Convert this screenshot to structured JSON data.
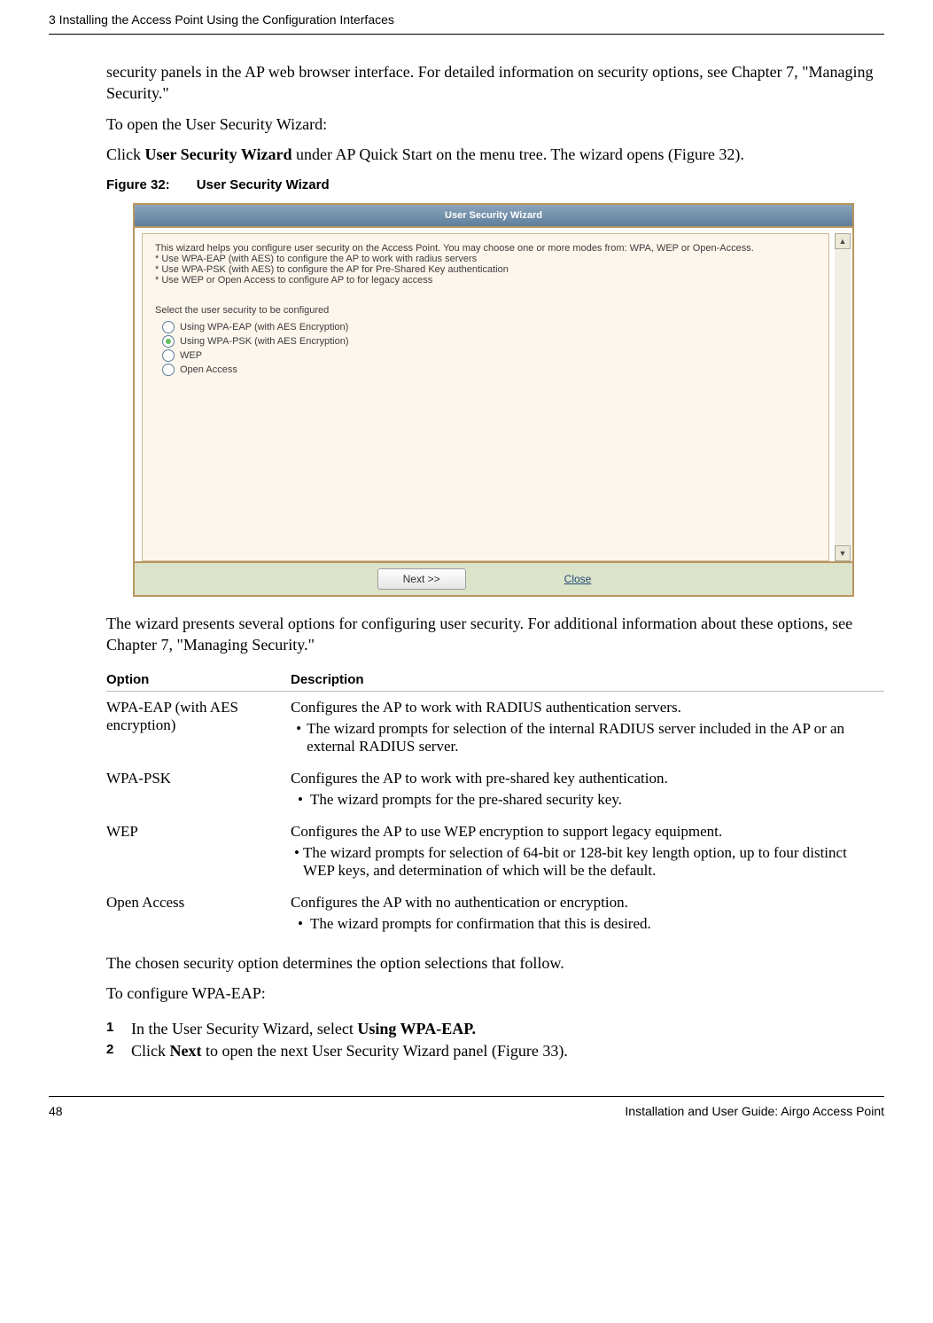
{
  "header": {
    "chapter": "3  Installing the Access Point Using the Configuration Interfaces"
  },
  "intro": {
    "p1": "security panels in the AP web browser interface. For detailed information on security options, see Chapter 7,  \"Managing Security.\"",
    "p2": "To open the User Security Wizard:",
    "p3a": "Click ",
    "p3b": "User Security Wizard",
    "p3c": " under AP Quick Start on the menu tree. The wizard opens (Figure 32)."
  },
  "figure": {
    "label_prefix": "Figure 32:",
    "label_title": "User Security Wizard"
  },
  "wizard": {
    "title": "User Security Wizard",
    "intro": "This wizard helps you configure user security on the Access Point. You may choose one or more modes from: WPA, WEP or Open-Access.\n* Use WPA-EAP (with AES) to configure the AP to work with radius servers\n* Use WPA-PSK (with AES) to configure the AP for Pre-Shared Key authentication\n* Use WEP or Open Access to configure AP to for legacy access",
    "select_label": "Select the user security to be configured",
    "options": {
      "o1": "Using WPA-EAP (with AES Encryption)",
      "o2": "Using WPA-PSK (with AES Encryption)",
      "o3": "WEP",
      "o4": "Open Access"
    },
    "next_btn": "Next >>",
    "close_btn": "Close"
  },
  "after_fig": "The wizard presents several options for configuring user security. For additional information about these options, see Chapter 7,  \"Managing Security.\"",
  "table": {
    "h1": "Option",
    "h2": "Description",
    "rows": {
      "r1": {
        "opt": "WPA-EAP (with AES encryption)",
        "desc": "Configures the AP to work with RADIUS authentication servers.",
        "bullet": "The wizard prompts for selection of the internal RADIUS server included in the AP or an external RADIUS server."
      },
      "r2": {
        "opt": "WPA-PSK",
        "desc": "Configures the AP to work with pre-shared key authentication.",
        "bullet": "The wizard prompts for the pre-shared security key."
      },
      "r3": {
        "opt": "WEP",
        "desc": "Configures the AP to use WEP encryption to support legacy equipment.",
        "bullet": "The wizard prompts for selection of 64-bit or 128-bit key length option, up to four distinct WEP keys, and determination of which will be the default."
      },
      "r4": {
        "opt": "Open Access",
        "desc": "Configures the AP with no authentication or encryption.",
        "bullet": "The wizard prompts for confirmation that this is desired."
      }
    }
  },
  "closing": {
    "p1": "The chosen security option determines the option selections that follow.",
    "p2": "To configure WPA-EAP:",
    "step1a": "In the User Security Wizard, select ",
    "step1b": "Using WPA-EAP.",
    "step2a": "Click ",
    "step2b": "Next",
    "step2c": " to open the next User Security Wizard panel (Figure 33)."
  },
  "footer": {
    "page": "48",
    "title": "Installation and User Guide: Airgo Access Point"
  }
}
